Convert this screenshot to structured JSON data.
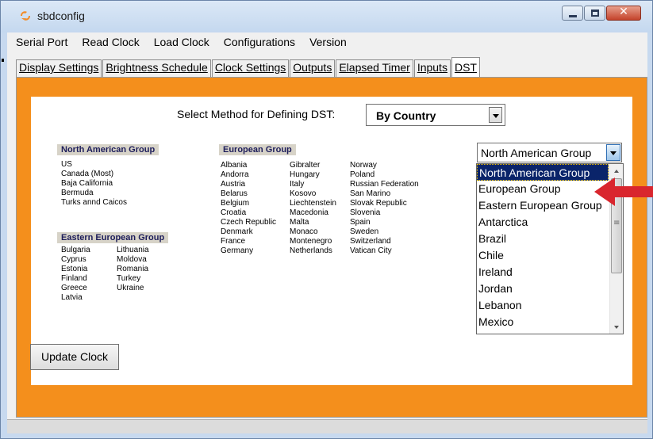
{
  "window": {
    "title": "sbdconfig",
    "app_icon": "sbd-logo-icon"
  },
  "menu": [
    "Serial Port",
    "Read Clock",
    "Load Clock",
    "Configurations",
    "Version"
  ],
  "tabs": [
    {
      "label": "Display Settings",
      "active": false
    },
    {
      "label": "Brightness Schedule",
      "active": false
    },
    {
      "label": "Clock Settings",
      "active": false
    },
    {
      "label": "Outputs",
      "active": false
    },
    {
      "label": "Elapsed Timer",
      "active": false
    },
    {
      "label": "Inputs",
      "active": false
    },
    {
      "label": "DST",
      "active": true
    }
  ],
  "dst": {
    "method_label": "Select Method for Defining DST:",
    "method_value": "By Country",
    "north_american": {
      "title": "North American Group",
      "items": [
        "US",
        "Canada (Most)",
        "Baja California",
        "Bermuda",
        "Turks annd Caicos"
      ]
    },
    "eastern_european": {
      "title": "Eastern European Group",
      "col1": [
        "Bulgaria",
        "Cyprus",
        "Estonia",
        "Finland",
        "Greece",
        "Latvia"
      ],
      "col2": [
        "Lithuania",
        "Moldova",
        "Romania",
        "Turkey",
        "Ukraine"
      ]
    },
    "european": {
      "title": "European Group",
      "col1": [
        "Albania",
        "Andorra",
        "Austria",
        "Belarus",
        "Belgium",
        "Croatia",
        "Czech Republic",
        "Denmark",
        "France",
        "Germany"
      ],
      "col2": [
        "Gibralter",
        "Hungary",
        "Italy",
        "Kosovo",
        "Liechtenstein",
        "Macedonia",
        "Malta",
        "Monaco",
        "Montenegro",
        "Netherlands"
      ],
      "col3": [
        "Norway",
        "Poland",
        "Russian Federation",
        "San Marino",
        "Slovak Republic",
        "Slovenia",
        "Spain",
        "Sweden",
        "Switzerland",
        "Vatican City"
      ]
    },
    "group_select_value": "North American Group",
    "group_options": [
      "North American Group",
      "European Group",
      "Eastern European Group",
      "Antarctica",
      "Brazil",
      "Chile",
      "Ireland",
      "Jordan",
      "Lebanon",
      "Mexico"
    ],
    "group_selected_index": 0,
    "update_button": "Update Clock"
  },
  "colors": {
    "panel": "#f48f1c",
    "selection": "#0a246a",
    "annotation_arrow": "#d9262e"
  }
}
